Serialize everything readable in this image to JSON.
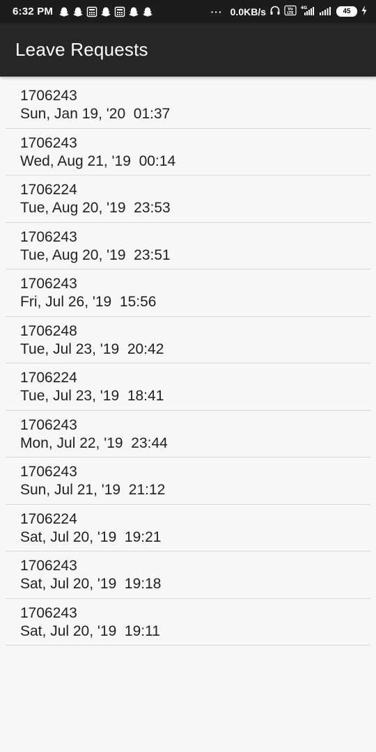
{
  "status_bar": {
    "time": "6:32 PM",
    "dots": "···",
    "net_speed": "0.0KB/s",
    "volte": "Vo LTE",
    "network": "4G",
    "battery": "45",
    "notification_icons": [
      "snapchat-icon",
      "snapchat-icon",
      "calculator-icon",
      "snapchat-icon",
      "calculator-icon",
      "snapchat-icon",
      "snapchat-icon"
    ]
  },
  "app_bar": {
    "title": "Leave Requests"
  },
  "requests": [
    {
      "id": "1706243",
      "date": "Sun, Jan 19, '20  01:37"
    },
    {
      "id": "1706243",
      "date": "Wed, Aug 21, '19  00:14"
    },
    {
      "id": "1706224",
      "date": "Tue, Aug 20, '19  23:53"
    },
    {
      "id": "1706243",
      "date": "Tue, Aug 20, '19  23:51"
    },
    {
      "id": "1706243",
      "date": "Fri, Jul 26, '19  15:56"
    },
    {
      "id": "1706248",
      "date": "Tue, Jul 23, '19  20:42"
    },
    {
      "id": "1706224",
      "date": "Tue, Jul 23, '19  18:41"
    },
    {
      "id": "1706243",
      "date": "Mon, Jul 22, '19  23:44"
    },
    {
      "id": "1706243",
      "date": "Sun, Jul 21, '19  21:12"
    },
    {
      "id": "1706224",
      "date": "Sat, Jul 20, '19  19:21"
    },
    {
      "id": "1706243",
      "date": "Sat, Jul 20, '19  19:18"
    },
    {
      "id": "1706243",
      "date": "Sat, Jul 20, '19  19:11"
    }
  ]
}
